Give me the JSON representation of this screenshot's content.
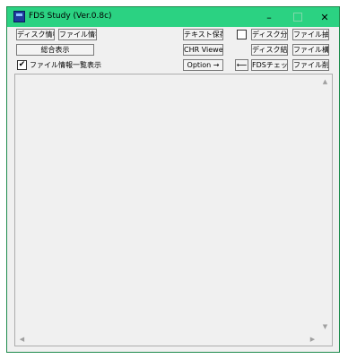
{
  "window": {
    "title": "FDS Study (Ver.0.8c)",
    "controls": {
      "minimize": "–",
      "close": "✕"
    }
  },
  "toolbar": {
    "disk_info": "ディスク情報",
    "file_info": "ファイル情報",
    "summary_display": "総合表示",
    "file_list_checkbox_mark": "✔",
    "file_list_label": "ファイル情報一覧表示",
    "save_text": "テキスト保存",
    "chr_viewer": "CHR Viewer",
    "option": "Option →",
    "disk_split": "ディスク分割",
    "disk_merge": "ディスク結合",
    "fds_check": "FDSチェック",
    "file_extract": "ファイル抽出",
    "file_rebuild": "ファイル構築",
    "file_delete": "ファイル削除",
    "arrow_left": "⟵"
  },
  "scrollbars": {
    "up": "▲",
    "down": "▼",
    "left": "◀",
    "right": "▶"
  }
}
